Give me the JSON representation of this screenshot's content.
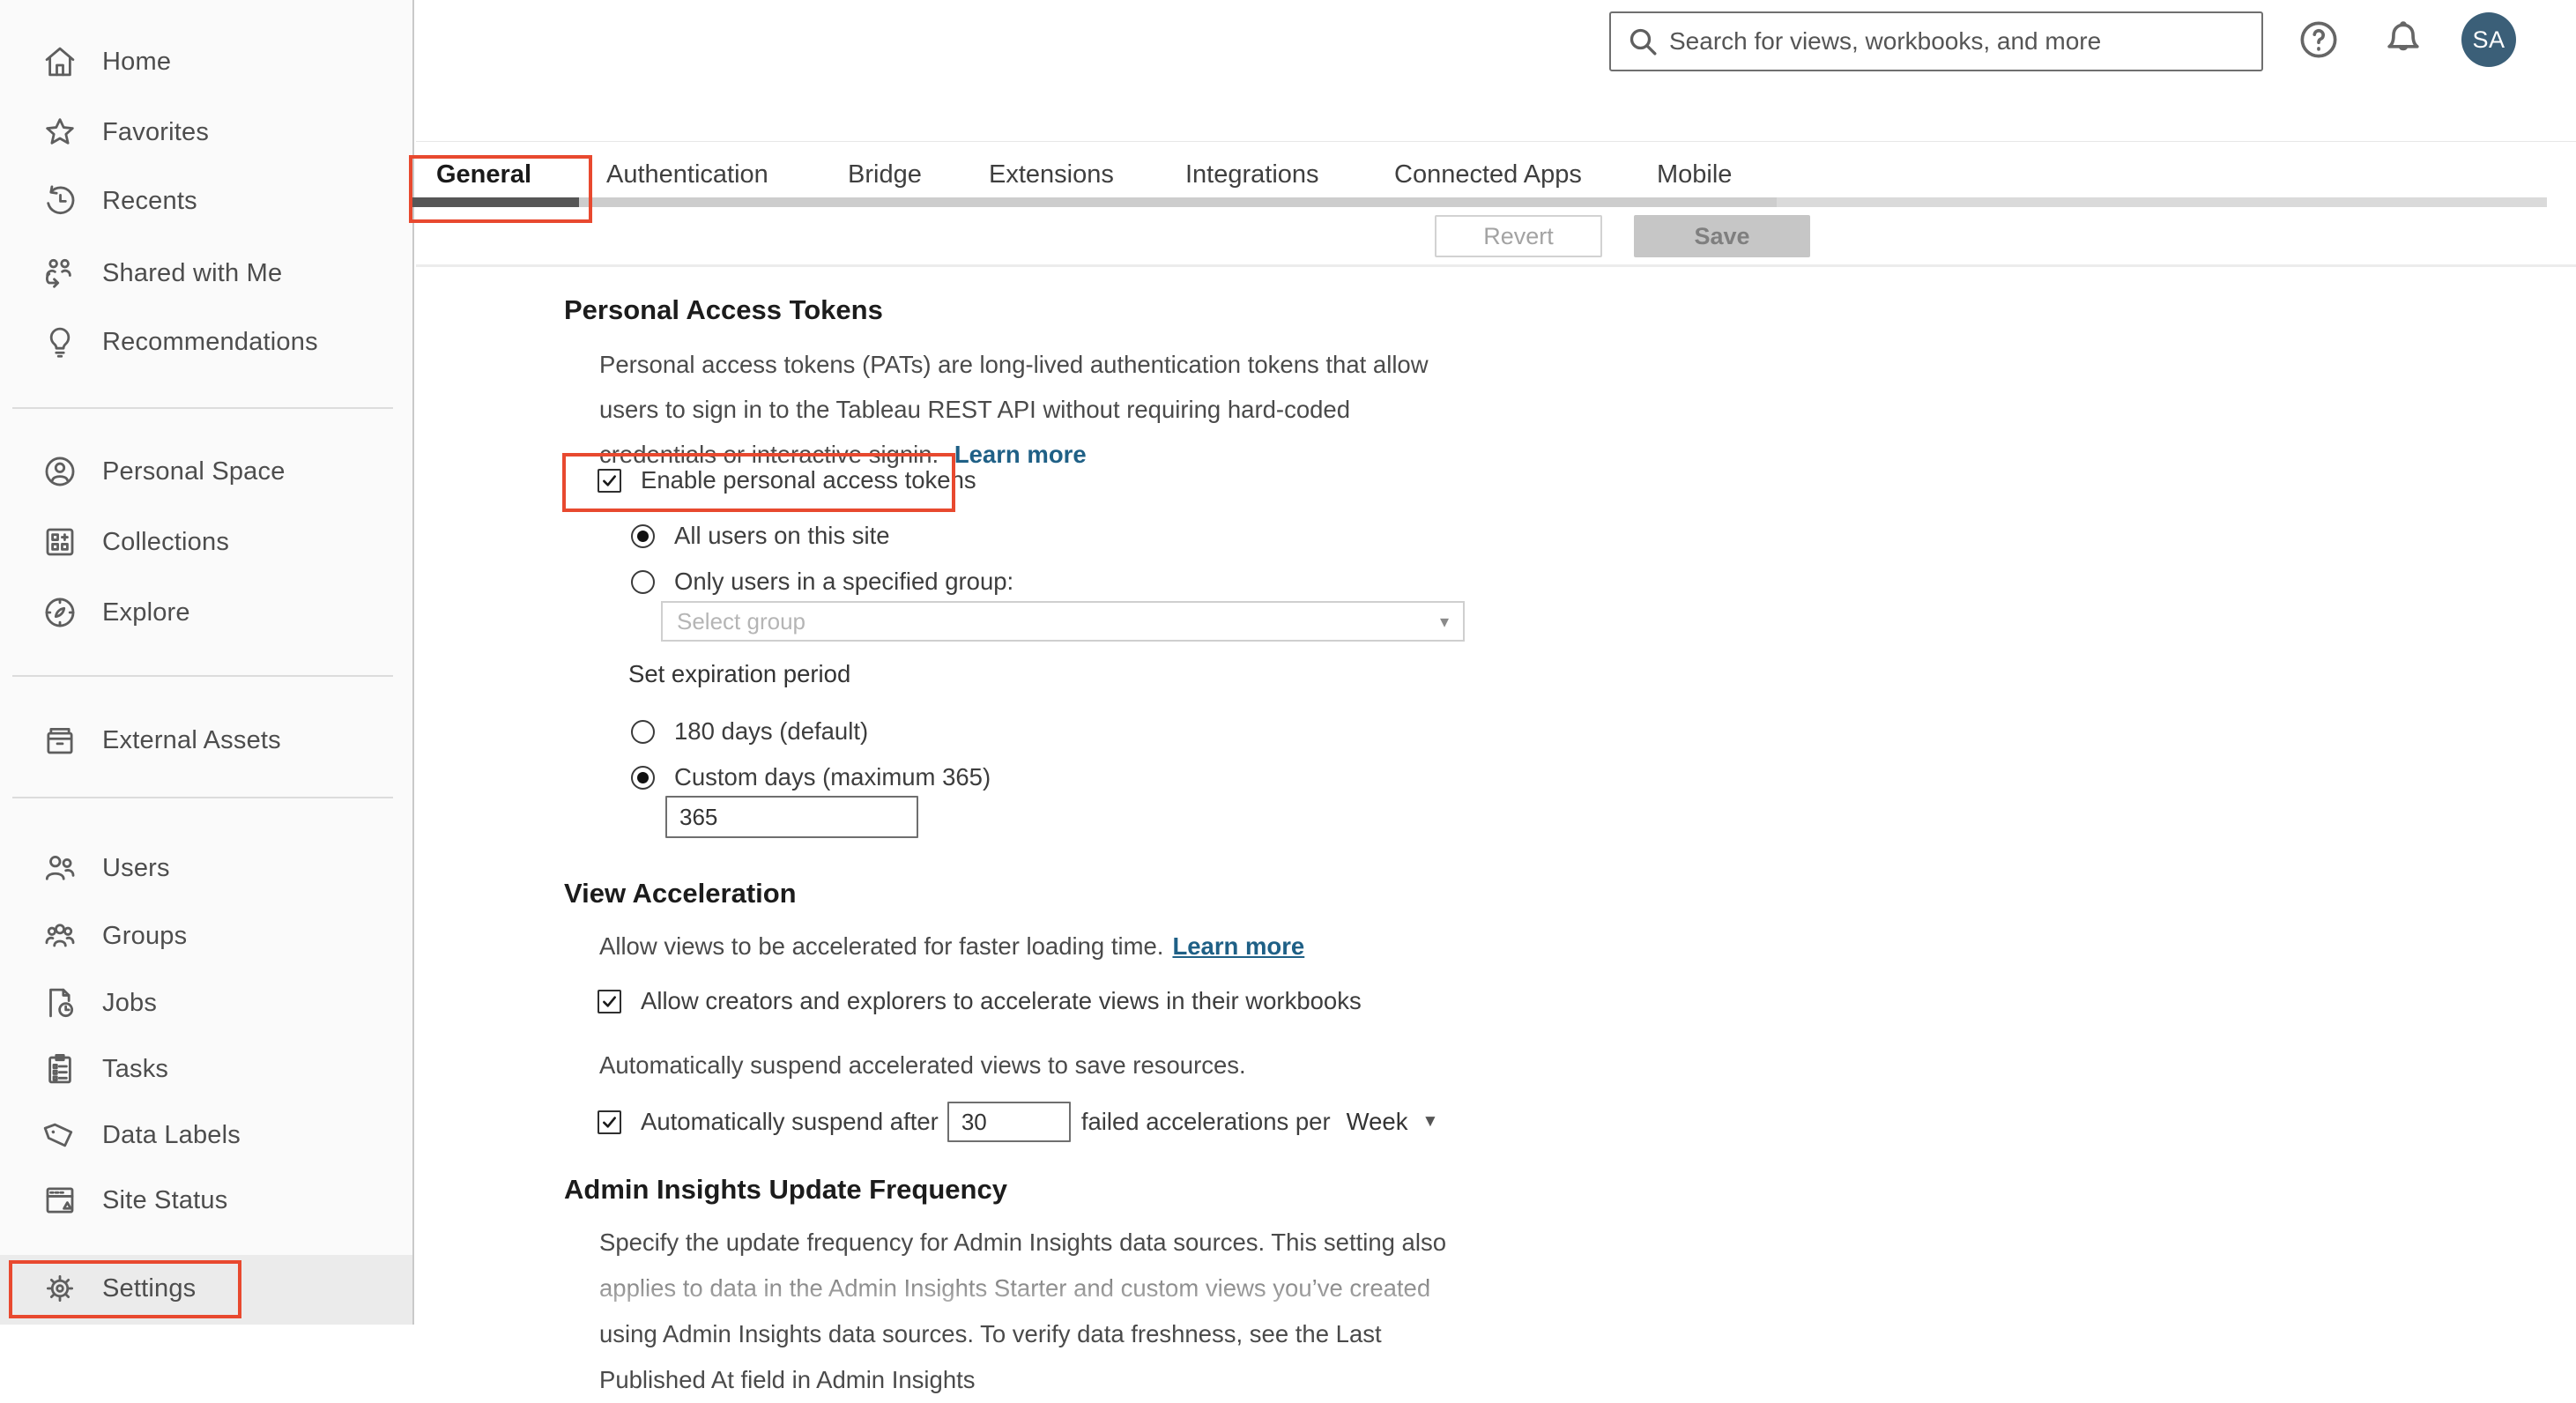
{
  "topbar": {
    "search_placeholder": "Search for views, workbooks, and more",
    "avatar_initials": "SA"
  },
  "sidebar": {
    "items": [
      {
        "label": "Home"
      },
      {
        "label": "Favorites"
      },
      {
        "label": "Recents"
      },
      {
        "label": "Shared with Me"
      },
      {
        "label": "Recommendations"
      },
      {
        "label": "Personal Space"
      },
      {
        "label": "Collections"
      },
      {
        "label": "Explore"
      },
      {
        "label": "External Assets"
      },
      {
        "label": "Users"
      },
      {
        "label": "Groups"
      },
      {
        "label": "Jobs"
      },
      {
        "label": "Tasks"
      },
      {
        "label": "Data Labels"
      },
      {
        "label": "Site Status"
      },
      {
        "label": "Settings"
      }
    ]
  },
  "tabs": {
    "items": [
      {
        "label": "General"
      },
      {
        "label": "Authentication"
      },
      {
        "label": "Bridge"
      },
      {
        "label": "Extensions"
      },
      {
        "label": "Integrations"
      },
      {
        "label": "Connected Apps"
      },
      {
        "label": "Mobile"
      }
    ],
    "revert_label": "Revert",
    "save_label": "Save"
  },
  "content": {
    "pat": {
      "title": "Personal Access Tokens",
      "description": "Personal access tokens (PATs) are long-lived authentication tokens that allow users to sign in to the Tableau REST API without requiring hard-coded credentials or interactive signin.",
      "learn_more": "Learn more",
      "enable_checkbox_label": "Enable personal access tokens",
      "radio_all_users": "All users on this site",
      "radio_specified_group": "Only users in a specified group:",
      "select_group_placeholder": "Select group",
      "expiration_label": "Set expiration period",
      "radio_180_days": "180 days (default)",
      "radio_custom_days": "Custom days (maximum 365)",
      "custom_days_value": "365"
    },
    "view_acceleration": {
      "title": "View Acceleration",
      "description": "Allow views to be accelerated for faster loading time.",
      "learn_more": "Learn more",
      "checkbox_allow_label": "Allow creators and explorers to accelerate views in their workbooks",
      "suspend_note": "Automatically suspend accelerated views to save resources.",
      "checkbox_suspend_prefix": "Automatically suspend after",
      "suspend_count_value": "30",
      "checkbox_suspend_suffix": "failed accelerations per",
      "period_value": "Week"
    },
    "admin_insights": {
      "title": "Admin Insights Update Frequency",
      "description": "Specify the update frequency for Admin Insights data sources. This setting also applies to data in the Admin Insights Starter and custom views you’ve created using Admin Insights data sources. To verify data freshness, see the Last Published At field in Admin Insights"
    }
  },
  "colors": {
    "accent_red": "#e8492f",
    "link_blue": "#1f6086",
    "avatar_bg": "#3b5f78"
  }
}
